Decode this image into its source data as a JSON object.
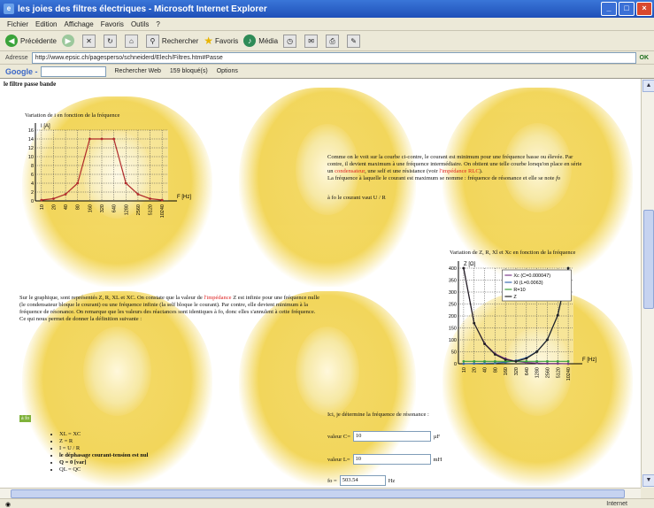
{
  "window": {
    "title": "les joies des filtres électriques - Microsoft Internet Explorer",
    "min": "_",
    "max": "□",
    "close": "×"
  },
  "menu": [
    "Fichier",
    "Edition",
    "Affichage",
    "Favoris",
    "Outils",
    "?"
  ],
  "toolbar": {
    "back": "Précédente",
    "search": "Rechercher",
    "favorites": "Favoris",
    "media": "Média"
  },
  "address": {
    "label": "Adresse",
    "url": "http://www.epsic.ch/pagesperso/schneiderd/Elech/Filtres.htm#Passe",
    "go": "OK"
  },
  "google": {
    "logo": "Google -",
    "search_web": "Rechercher Web",
    "blocked": "159 bloqué(s)",
    "options": "Options"
  },
  "page": {
    "heading": "le filtre passe bande",
    "chart1_title": "Variation de i en fonction de la fréquence",
    "para1": "Comme on le voit sur la courbe ci-contre, le courant est minimum pour une fréquence basse ou élevée. Par contre, il devient maximum à une fréquence intermédiaire. On obtient une telle courbe lorsqu'on place en série un",
    "para1_red": "condensateur",
    "para1_b": ", une self et une résistance (voir",
    "para1_red2": "l'impédance RLC",
    "para1_c": ").",
    "para2": "La fréquence à laquelle le courant est maximum se nomme : fréquence de résonance et elle se note",
    "para2_sym": "fo",
    "para3": "à fo le courant vaut U / R",
    "chart2_title": "Variation de Z, R, Xl et Xc en fonction de la fréquence",
    "para4": "Sur le graphique, sont représentés Z, R, XL et XC. On constate que la valeur de",
    "para4_red": "l'impédance",
    "para4_b": "Z est infinie pour une fréquence nulle (le condensateur bloque le courant) ou une fréquence infinie (la self bloque le courant). Par contre, elle devient minimum à la fréquence de résonance. On remarque que les valeurs des réactances sont identiques à fo, donc elles s'annulent à cette fréquence. Ce qui nous permet de donner la définition suivante :",
    "highlight": "à fo",
    "bullets": [
      "XL = XC",
      "Z = R",
      "I = U / R",
      "le déphasage courant-tension est nul",
      "Q = 0 [var]",
      "QL = QC"
    ],
    "calc_title": "Ici, je détermine la fréquence de résonance :",
    "c_label": "valeur C=",
    "c_value": "10",
    "c_unit": "µF",
    "l_label": "valeur L=",
    "l_value": "10",
    "l_unit": "mH",
    "f_label": "fo =",
    "f_value": "503.54",
    "f_unit": "Hz"
  },
  "status": {
    "zone": "Internet"
  },
  "chart_data": [
    {
      "type": "line",
      "title": "Variation de i en fonction de la fréquence",
      "ylabel": "I [A]",
      "xlabel": "F [Hz]",
      "categories": [
        "10",
        "20",
        "40",
        "80",
        "160",
        "320",
        "640",
        "1280",
        "2560",
        "5120",
        "10240"
      ],
      "ylim": [
        0,
        16
      ],
      "yticks": [
        0,
        2,
        4,
        6,
        8,
        10,
        12,
        14,
        16
      ],
      "series": [
        {
          "values": [
            0.2,
            0.5,
            1.5,
            4,
            14,
            14,
            14,
            4,
            1.5,
            0.5,
            0.2
          ]
        }
      ],
      "color": "#b02a2a",
      "grid": true
    },
    {
      "type": "line",
      "title": "Variation de Z, R, Xl et Xc en fonction de la fréquence",
      "ylabel": "Z [Ω]",
      "xlabel": "F [Hz]",
      "categories": [
        "10",
        "20",
        "40",
        "80",
        "160",
        "320",
        "640",
        "1280",
        "2560",
        "5120",
        "10240"
      ],
      "ylim": [
        0,
        400
      ],
      "yticks": [
        0,
        50,
        100,
        150,
        200,
        250,
        300,
        350,
        400
      ],
      "grid": true,
      "legend": "top-right",
      "series": [
        {
          "name": "Xc (C=0.000047)",
          "color": "#7a3a8a",
          "values": [
            400,
            170,
            85,
            42,
            21,
            10,
            5,
            3,
            1,
            1,
            0
          ]
        },
        {
          "name": "Xl (L=0.0063)",
          "color": "#3a6ab0",
          "values": [
            0,
            1,
            2,
            3,
            6,
            13,
            25,
            51,
            101,
            203,
            400
          ]
        },
        {
          "name": "R=10",
          "color": "#3aa03a",
          "values": [
            10,
            10,
            10,
            10,
            10,
            10,
            10,
            10,
            10,
            10,
            10
          ]
        },
        {
          "name": "Z",
          "color": "#222222",
          "values": [
            400,
            170,
            83,
            39,
            17,
            10,
            22,
            50,
            100,
            203,
            400
          ]
        }
      ]
    }
  ]
}
